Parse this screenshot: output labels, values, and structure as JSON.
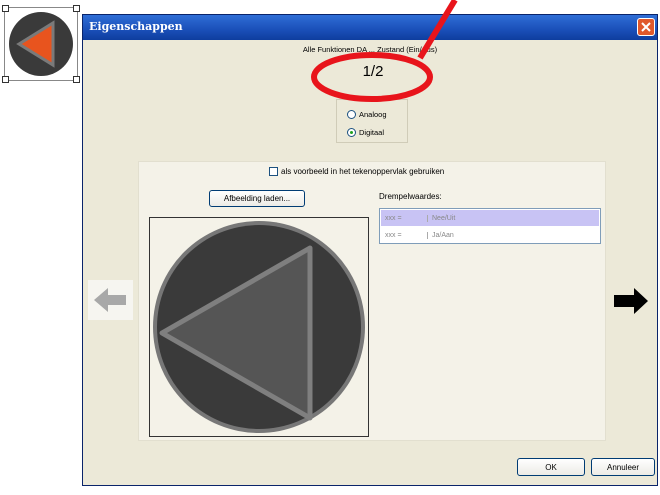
{
  "window": {
    "title": "Eigenschappen",
    "close_icon": "close-icon"
  },
  "header": {
    "subtitle": "Alle Funktionen DA ... Zustand (Ein/Aus)",
    "page_indicator": "1/2"
  },
  "mode": {
    "options": [
      {
        "label": "Analoog",
        "checked": false
      },
      {
        "label": "Digitaal",
        "checked": true
      }
    ]
  },
  "panel": {
    "example_checkbox_label": "als voorbeeld in het tekenoppervlak gebruiken",
    "example_checkbox_checked": false,
    "load_image_button": "Afbeelding laden...",
    "thresholds": {
      "label": "Drempelwaardes:",
      "rows": [
        {
          "value": "xxx =",
          "state": "Nee/Uit",
          "selected": true
        },
        {
          "value": "xxx =",
          "state": "Ja/Aan",
          "selected": false
        }
      ]
    }
  },
  "nav": {
    "prev_icon": "arrow-left-icon",
    "next_icon": "arrow-right-icon"
  },
  "footer": {
    "ok_label": "OK",
    "cancel_label": "Annuleer"
  },
  "colors": {
    "annotation_red": "#e8141b",
    "thumbnail_orange": "#e8541e",
    "title_blue": "#1a4fb8",
    "selected_row": "#c8c3f4"
  }
}
